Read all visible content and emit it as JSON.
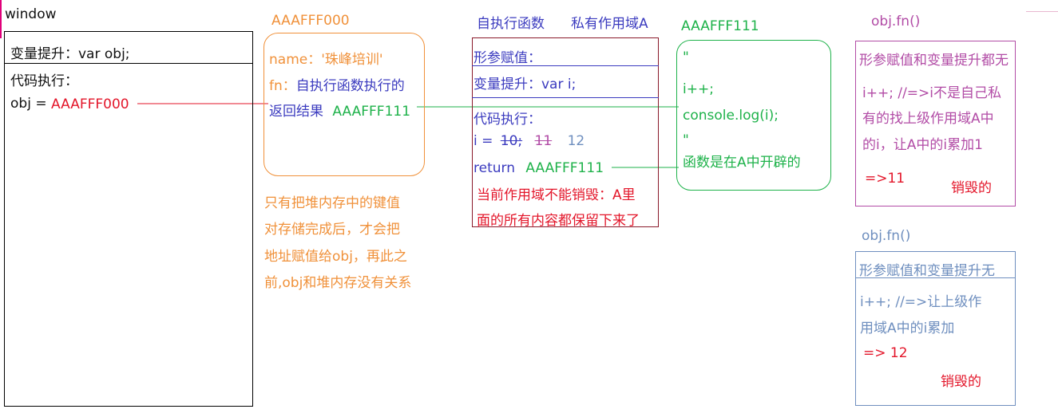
{
  "window": {
    "title": "window",
    "hoist_line": "变量提升：var obj;",
    "exec_title": "代码执行：",
    "obj_label": "obj =",
    "obj_value": "AAAFFF000"
  },
  "heap_a": {
    "address": "AAAFFF000",
    "name_line": "name：'珠峰培训'",
    "fn_key": "fn：",
    "fn_value_1": "自执行函数执行的",
    "fn_value_2": "返回结果",
    "fn_value_address": "AAAFFF111",
    "note_lines": [
      "只有把堆内存中的键值",
      "对存储完成后，才会把",
      "地址赋值给obj，再此之",
      "前,obj和堆内存没有关系"
    ]
  },
  "scope_a": {
    "header_left": "自执行函数",
    "header_right": "私有作用域A",
    "param_line": "形参赋值：",
    "hoist_line": "变量提升：var i;",
    "exec_title": "代码执行：",
    "i_prefix": "i =",
    "i_v1": "10;",
    "i_v2": "11",
    "i_v3": "12",
    "return_label": "return",
    "return_value": "AAAFFF111",
    "note_line_1": "当前作用域不能销毁：A里",
    "note_line_2": "面的所有内容都保留下来了"
  },
  "heap_b": {
    "address": "AAAFFF111",
    "quote_1": "\"",
    "code_1": "i++;",
    "code_2": "console.log(i);",
    "quote_2": "\"",
    "note": "函数是在A中开辟的"
  },
  "call_1": {
    "title": "obj.fn()",
    "header": "形参赋值和变量提升都无",
    "line_1": "i++; //=>i不是自己私",
    "line_2": "有的找上级作用域A中",
    "line_3": "的i，让A中的i累加1",
    "result": "=>11",
    "destroy": "销毁的"
  },
  "call_2": {
    "title": "obj.fn()",
    "header": "形参赋值和变量提升无",
    "line_1": "i++; //=>让上级作",
    "line_2": "用域A中的i累加",
    "result": "=> 12",
    "destroy": "销毁的"
  },
  "colors": {
    "red": "#e3162a",
    "orange": "#f0913a",
    "navy": "#3b3bbf",
    "green": "#1eb24a",
    "purple": "#b24ca6",
    "slate": "#6f8fbf"
  }
}
